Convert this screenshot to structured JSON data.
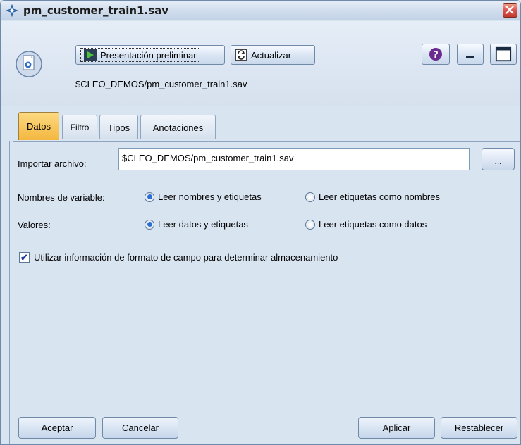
{
  "window": {
    "title": "pm_customer_train1.sav"
  },
  "toolbar": {
    "preview_label": "Presentación preliminar",
    "refresh_label": "Actualizar",
    "help_icon": "help-icon",
    "minimize_icon": "minimize-icon",
    "maximize_icon": "maximize-icon"
  },
  "node": {
    "path": "$CLEO_DEMOS/pm_customer_train1.sav",
    "icon": "statistics-file-node-icon"
  },
  "tabs": [
    {
      "label": "Datos",
      "active": true
    },
    {
      "label": "Filtro",
      "active": false
    },
    {
      "label": "Tipos",
      "active": false
    },
    {
      "label": "Anotaciones",
      "active": false
    }
  ],
  "form": {
    "import_label": "Importar archivo:",
    "import_value": "$CLEO_DEMOS/pm_customer_train1.sav",
    "browse_label": "...",
    "variable_names_label": "Nombres de variable:",
    "variable_names_options": [
      {
        "label": "Leer nombres y etiquetas",
        "selected": true
      },
      {
        "label": "Leer etiquetas como nombres",
        "selected": false
      }
    ],
    "values_label": "Valores:",
    "values_options": [
      {
        "label": "Leer datos y etiquetas",
        "selected": true
      },
      {
        "label": "Leer etiquetas como datos",
        "selected": false
      }
    ],
    "format_checkbox_label": "Utilizar información de formato de campo para determinar almacenamiento",
    "format_checkbox_checked": true
  },
  "buttons": {
    "ok": "Aceptar",
    "cancel": "Cancelar",
    "apply_prefix": "A",
    "apply_rest": "plicar",
    "reset_prefix": "R",
    "reset_rest": "establecer"
  },
  "colors": {
    "active_tab": "#f4b740",
    "radio_selected": "#2a6fd6",
    "close_button": "#d9534f"
  }
}
